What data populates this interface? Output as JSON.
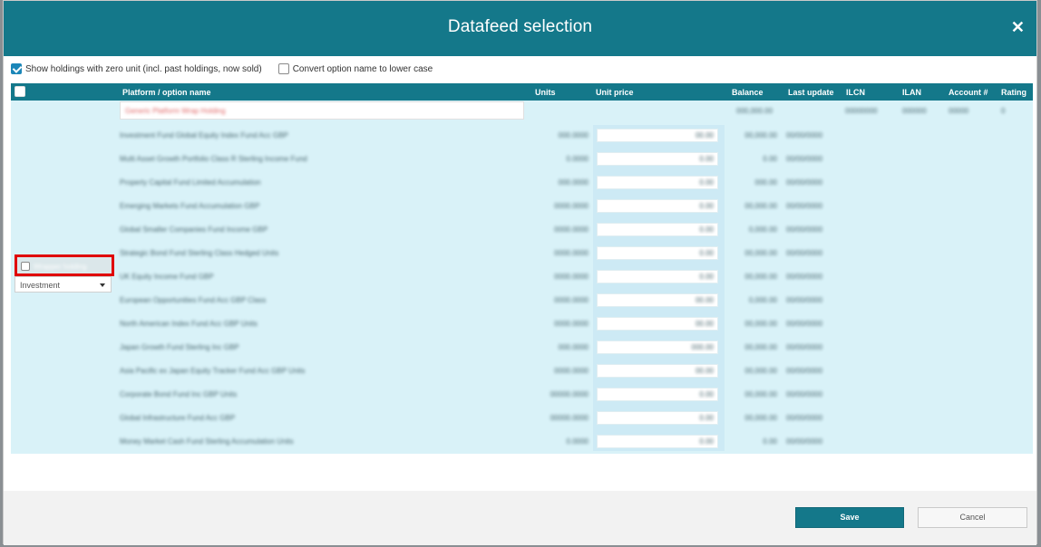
{
  "dialog": {
    "title": "Datafeed selection",
    "close_icon": "close-icon"
  },
  "options": {
    "zero_units": {
      "label": "Show holdings with zero unit (incl. past holdings, now sold)",
      "checked": true
    },
    "lowercase": {
      "label": "Convert option name to lower case",
      "checked": false
    }
  },
  "table": {
    "columns": {
      "platform": "Platform / option name",
      "units": "Units",
      "unit_price": "Unit price",
      "balance": "Balance",
      "last_update": "Last update",
      "ilcn": "ILCN",
      "ilan": "ILAN",
      "account": "Account #",
      "rating": "Rating"
    },
    "top_row": {
      "name": "Generic Platform Wrap Holding",
      "balance": "000,000.00",
      "ilcn": "00000000",
      "ilan": "000000",
      "account": "00000",
      "rating": "0"
    },
    "rows": [
      {
        "name": "Investment Fund Global Equity Index Fund Acc GBP",
        "units": "000.0000",
        "price": "00.00",
        "balance": "00,000.00",
        "update": "00/00/0000"
      },
      {
        "name": "Multi Asset Growth Portfolio Class R Sterling Income Fund",
        "units": "0.0000",
        "price": "0.00",
        "balance": "0.00",
        "update": "00/00/0000"
      },
      {
        "name": "Property Capital Fund Limited Accumulation",
        "units": "000.0000",
        "price": "0.00",
        "balance": "000.00",
        "update": "00/00/0000"
      },
      {
        "name": "Emerging Markets Fund Accumulation GBP",
        "units": "0000.0000",
        "price": "0.00",
        "balance": "00,000.00",
        "update": "00/00/0000"
      },
      {
        "name": "Global Smaller Companies Fund Income GBP",
        "units": "0000.0000",
        "price": "0.00",
        "balance": "0,000.00",
        "update": "00/00/0000"
      },
      {
        "name": "Strategic Bond Fund Sterling Class Hedged Units",
        "units": "0000.0000",
        "price": "0.00",
        "balance": "00,000.00",
        "update": "00/00/0000"
      },
      {
        "name": "UK Equity Income Fund GBP",
        "units": "0000.0000",
        "price": "0.00",
        "balance": "00,000.00",
        "update": "00/00/0000"
      },
      {
        "name": "European Opportunities Fund Acc GBP Class",
        "units": "0000.0000",
        "price": "00.00",
        "balance": "0,000.00",
        "update": "00/00/0000"
      },
      {
        "name": "North American Index Fund Acc GBP Units",
        "units": "0000.0000",
        "price": "00.00",
        "balance": "00,000.00",
        "update": "00/00/0000"
      },
      {
        "name": "Japan Growth Fund Sterling Inc GBP",
        "units": "000.0000",
        "price": "000.00",
        "balance": "00,000.00",
        "update": "00/00/0000"
      },
      {
        "name": "Asia Pacific ex Japan Equity Tracker Fund Acc GBP Units",
        "units": "0000.0000",
        "price": "00.00",
        "balance": "00,000.00",
        "update": "00/00/0000"
      },
      {
        "name": "Corporate Bond Fund Inc GBP Units",
        "units": "00000.0000",
        "price": "0.00",
        "balance": "00,000.00",
        "update": "00/00/0000"
      },
      {
        "name": "Global Infrastructure Fund Acc GBP",
        "units": "00000.0000",
        "price": "0.00",
        "balance": "00,000.00",
        "update": "00/00/0000"
      },
      {
        "name": "Money Market Cash Fund Sterling Accumulation Units",
        "units": "0.0000",
        "price": "0.00",
        "balance": "0.00",
        "update": "00/00/0000"
      }
    ]
  },
  "side": {
    "checkbox_label": "Wrapper holding",
    "type_select": {
      "value": "Investment"
    }
  },
  "footer": {
    "save_label": "Save",
    "cancel_label": "Cancel"
  }
}
